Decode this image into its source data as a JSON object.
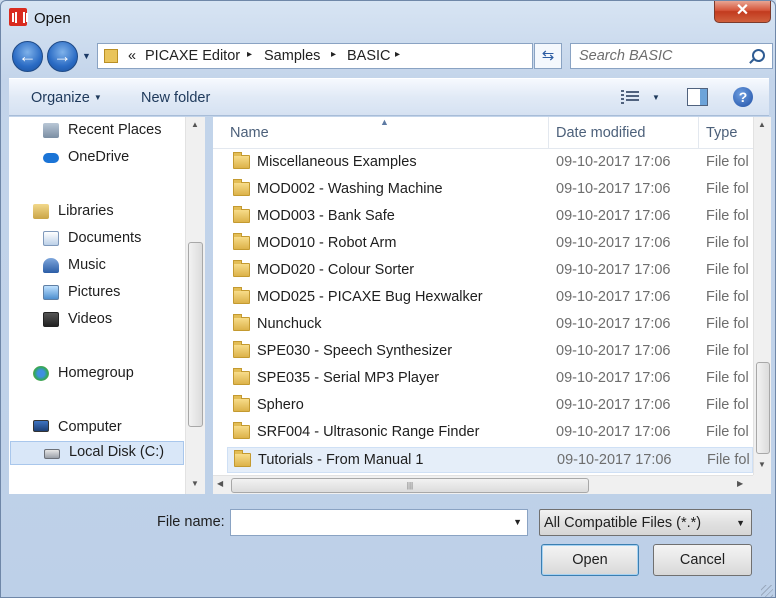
{
  "window": {
    "title": "Open"
  },
  "titlebar": {
    "close_glyph": "✕"
  },
  "nav": {
    "back_glyph": "←",
    "forward_glyph": "→"
  },
  "address": {
    "prefix": "«",
    "segments": [
      "PICAXE Editor",
      "Samples",
      "BASIC"
    ],
    "separator": "▸"
  },
  "search": {
    "placeholder": "Search BASIC"
  },
  "toolbar": {
    "organize_label": "Organize",
    "new_folder_label": "New folder",
    "help_glyph": "?"
  },
  "navpane": {
    "items": [
      {
        "label": "Recent Places",
        "icon": "recent-places-icon"
      },
      {
        "label": "OneDrive",
        "icon": "onedrive-icon"
      },
      {
        "label": "Libraries",
        "icon": "libraries-icon"
      },
      {
        "label": "Documents",
        "icon": "documents-icon"
      },
      {
        "label": "Music",
        "icon": "music-icon"
      },
      {
        "label": "Pictures",
        "icon": "pictures-icon"
      },
      {
        "label": "Videos",
        "icon": "videos-icon"
      },
      {
        "label": "Homegroup",
        "icon": "homegroup-icon"
      },
      {
        "label": "Computer",
        "icon": "computer-icon"
      },
      {
        "label": "Local Disk (C:)",
        "icon": "local-disk-icon",
        "selected": true
      }
    ]
  },
  "filelist": {
    "columns": [
      "Name",
      "Date modified",
      "Type"
    ],
    "rows": [
      {
        "name": "Miscellaneous Examples",
        "date": "09-10-2017 17:06",
        "type": "File fol"
      },
      {
        "name": "MOD002 - Washing Machine",
        "date": "09-10-2017 17:06",
        "type": "File fol"
      },
      {
        "name": "MOD003 - Bank Safe",
        "date": "09-10-2017 17:06",
        "type": "File fol"
      },
      {
        "name": "MOD010 - Robot Arm",
        "date": "09-10-2017 17:06",
        "type": "File fol"
      },
      {
        "name": "MOD020 - Colour Sorter",
        "date": "09-10-2017 17:06",
        "type": "File fol"
      },
      {
        "name": "MOD025 - PICAXE Bug Hexwalker",
        "date": "09-10-2017 17:06",
        "type": "File fol"
      },
      {
        "name": "Nunchuck",
        "date": "09-10-2017 17:06",
        "type": "File fol"
      },
      {
        "name": "SPE030 - Speech Synthesizer",
        "date": "09-10-2017 17:06",
        "type": "File fol"
      },
      {
        "name": "SPE035 - Serial MP3 Player",
        "date": "09-10-2017 17:06",
        "type": "File fol"
      },
      {
        "name": "Sphero",
        "date": "09-10-2017 17:06",
        "type": "File fol"
      },
      {
        "name": "SRF004 - Ultrasonic Range Finder",
        "date": "09-10-2017 17:06",
        "type": "File fol"
      },
      {
        "name": "Tutorials - From Manual 1",
        "date": "09-10-2017 17:06",
        "type": "File fol",
        "selected": true
      }
    ]
  },
  "footer": {
    "filename_label": "File name:",
    "filename_value": "",
    "filter_value": "All Compatible Files (*.*)",
    "open_label": "Open",
    "cancel_label": "Cancel"
  }
}
